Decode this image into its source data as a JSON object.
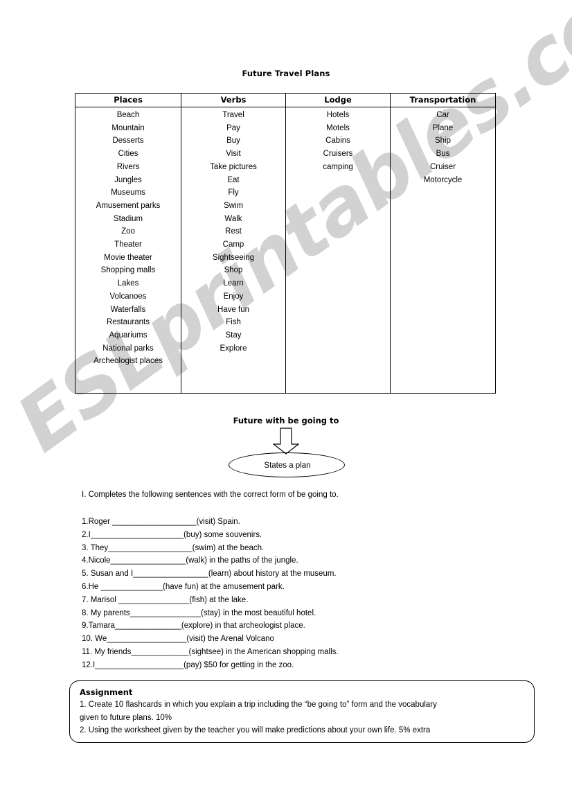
{
  "document": {
    "title": "Future Travel Plans"
  },
  "vocab_table": {
    "columns": [
      {
        "header": "Places",
        "items": [
          "Beach",
          "Mountain",
          "Desserts",
          "Cities",
          "Rivers",
          "Jungles",
          "Museums",
          "Amusement parks",
          "Stadium",
          "Zoo",
          "Theater",
          "Movie theater",
          "Shopping malls",
          "Lakes",
          "Volcanoes",
          "Waterfalls",
          "Restaurants",
          "Aquariums",
          "National parks",
          "Archeologist places"
        ]
      },
      {
        "header": "Verbs",
        "items": [
          "Travel",
          "Pay",
          "Buy",
          "Visit",
          "Take pictures",
          "Eat",
          "Fly",
          "Swim",
          "Walk",
          "Rest",
          "Camp",
          "Sightseeing",
          "Shop",
          "Learn",
          "Enjoy",
          "Have fun",
          "Fish",
          "Stay",
          "Explore"
        ]
      },
      {
        "header": "Lodge",
        "items": [
          "Hotels",
          "Motels",
          "Cabins",
          "Cruisers",
          "camping"
        ]
      },
      {
        "header": "Transportation",
        "items": [
          "Car",
          "Plane",
          "Ship",
          "Bus",
          "Cruiser",
          "Motorcycle"
        ]
      }
    ]
  },
  "diagram": {
    "title": "Future with be going to",
    "arrow_icon": "down-arrow-icon",
    "oval_label": "States a plan"
  },
  "exercise": {
    "instruction": "I. Completes the following sentences with the correct form of be going to.",
    "items": [
      "1.Roger ___________________(visit) Spain.",
      "2.I_____________________(buy) some souvenirs.",
      "3. They___________________(swim) at the beach.",
      "4.Nicole_________________(walk) in the paths of the jungle.",
      "5. Susan and I_________________(learn) about history at the museum.",
      "6.He ______________(have fun) at the amusement park.",
      "7. Marisol ________________(fish) at the lake.",
      "8. My parents________________(stay) in the most beautiful hotel.",
      "9.Tamara_______________(explore) in that archeologist place.",
      "10. We__________________(visit) the Arenal Volcano",
      "11. My friends_____________(sightsee) in the American shopping malls.",
      "12.I____________________(pay) $50 for getting in the zoo."
    ]
  },
  "assignment": {
    "heading": "Assignment",
    "lines": [
      "1. Create 10 flashcards in which you explain a trip including the “be going to” form and the vocabulary",
      "given to future plans. 10%",
      "2. Using the worksheet given by the teacher you will make predictions about your own life. 5% extra"
    ]
  },
  "watermark": {
    "text": "ESLprintables.com",
    "color": "#d2d2d2"
  }
}
